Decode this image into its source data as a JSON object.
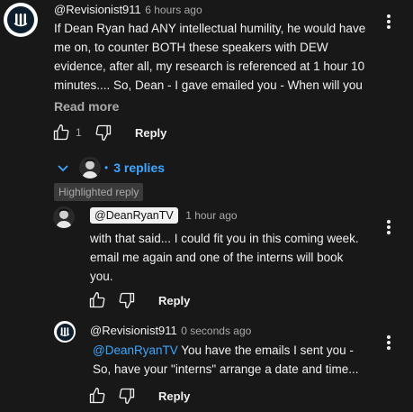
{
  "comment": {
    "author": "@Revisionist911",
    "time": "6 hours ago",
    "text": "If Dean Ryan had ANY intellectual humility, he would have me on, to counter BOTH these speakers with DEW evidence, after all, my research is referenced at 1 hour 10 minutes.... So, Dean - I gave emailed you - When will you …",
    "read_more": "Read more",
    "likes": "1",
    "reply_label": "Reply"
  },
  "thread": {
    "replies_label": "3 replies",
    "separator": "•"
  },
  "highlighted_label": "Highlighted reply",
  "reply1": {
    "author": "@DeanRyanTV",
    "time": "1 hour ago",
    "text": "with that said... I could fit you in this coming week. email me again and one of the interns will book you.",
    "reply_label": "Reply"
  },
  "reply2": {
    "author": "@Revisionist911",
    "time": "0 seconds ago",
    "mention": "@DeanRyanTV",
    "text": "You have the emails I sent you - So, have your \"interns\" arrange a date and time...",
    "reply_label": "Reply"
  },
  "colors": {
    "background": "#181818",
    "text": "#f1f1f1",
    "muted": "#aaaaaa",
    "link": "#3ea6ff"
  }
}
